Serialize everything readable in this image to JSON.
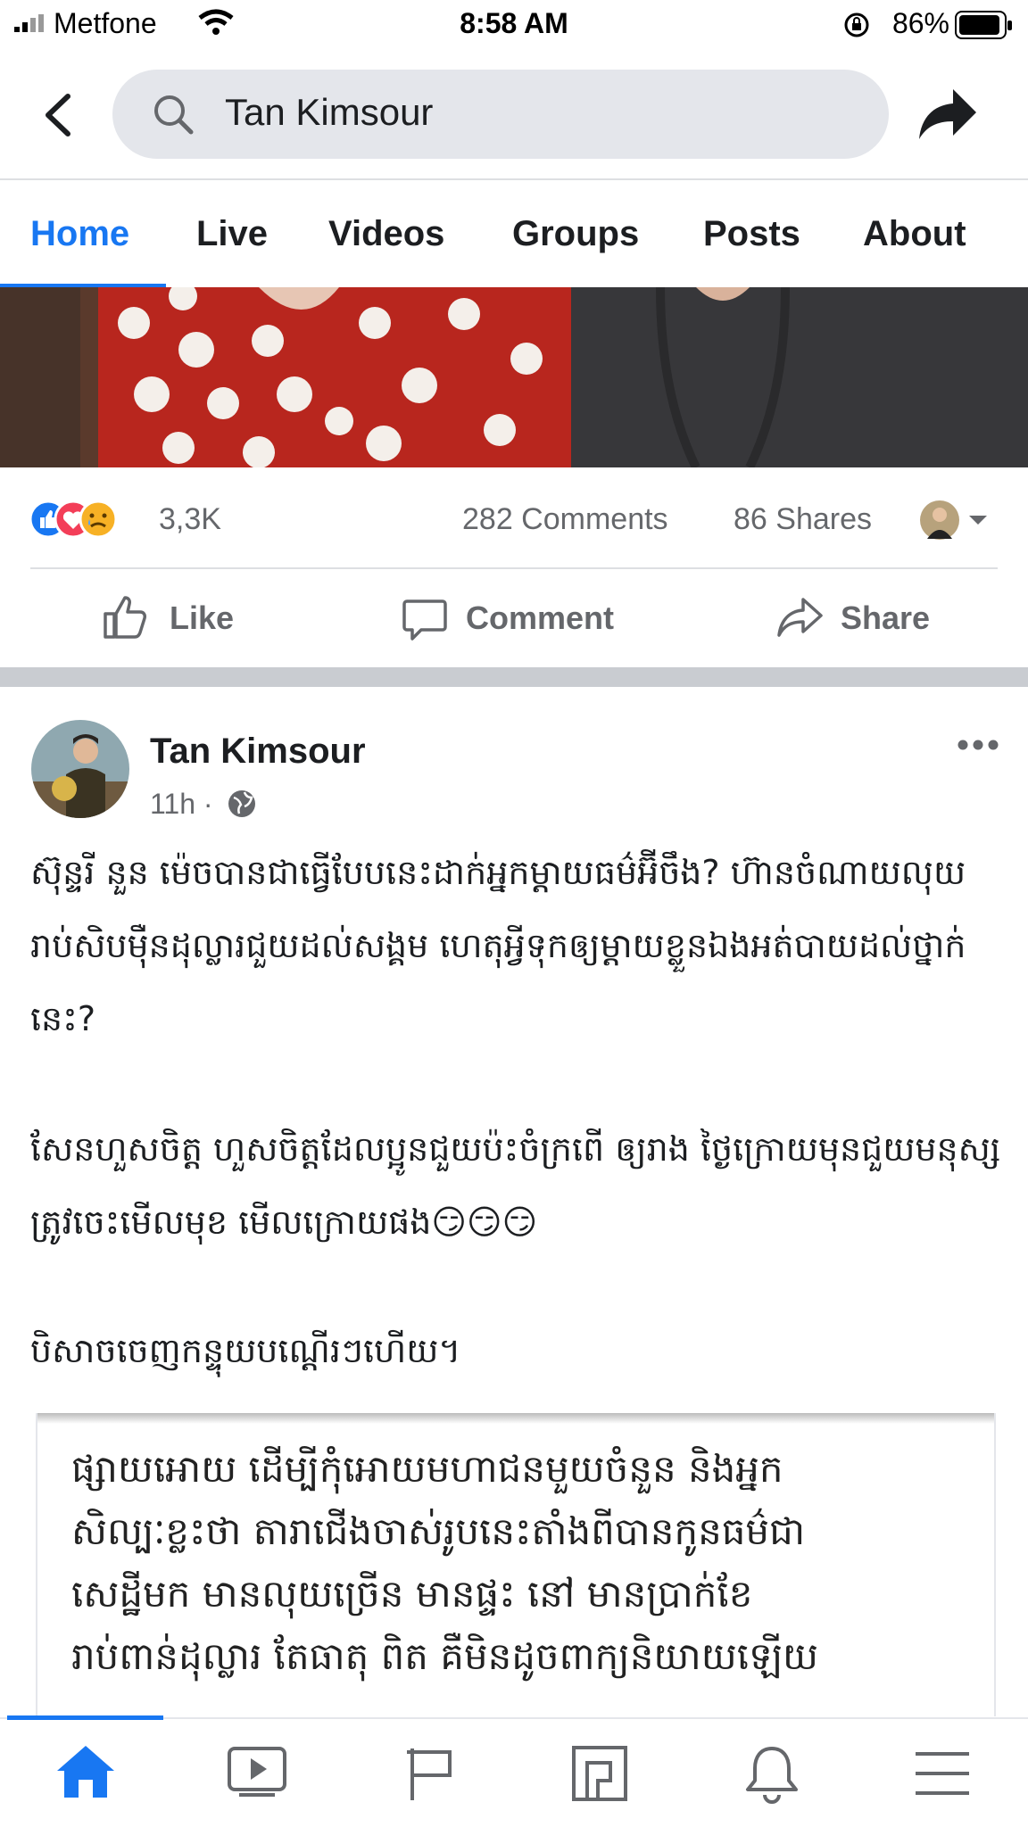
{
  "status_bar": {
    "carrier": "Metfone",
    "time": "8:58 AM",
    "battery": "86%"
  },
  "header": {
    "search_value": "Tan Kimsour",
    "icons": [
      "back-arrow-icon",
      "search-icon",
      "share-arrow-icon"
    ]
  },
  "tabs": [
    {
      "label": "Home",
      "active": true
    },
    {
      "label": "Live"
    },
    {
      "label": "Videos"
    },
    {
      "label": "Groups"
    },
    {
      "label": "Posts"
    },
    {
      "label": "About"
    }
  ],
  "feedback": {
    "reactions": "3,3K",
    "reaction_icons": [
      "like-reaction-icon",
      "love-reaction-icon",
      "sad-reaction-icon"
    ],
    "comments": "282 Comments",
    "shares": "86 Shares"
  },
  "actions": {
    "like": "Like",
    "comment": "Comment",
    "share": "Share"
  },
  "post": {
    "author": "Tan Kimsour",
    "time": "11h ·",
    "paragraphs": [
      "ស៊ុន្ទរី នួន ម៉េចបានជាធ្វើបែបនេះដាក់អ្នកម្តាយធម៌អ៊ីចឹង? ហ៊ានចំណាយលុយរាប់សិបម៉ឺនដុល្លារជួយដល់សង្គម ហេតុអ្វីទុកឲ្យម្តាយខ្លួនឯងអត់បាយដល់ថ្នាក់នេះ?",
      "សែនហួសចិត្ត ហួសចិត្តដែលប្អូនជួយប៉ះចំក្រពើ ឲ្យរាង ថ្ងៃក្រោយមុនជួយមនុស្ស ត្រូវចេះមើលមុខ មើលក្រោយផង😏😏😏",
      "បិសាចចេញកន្ទុយបណ្តើរៗហើយ។"
    ],
    "embedded_image_text": [
      "ផ្សាយអោយ ដើម្បីកុំអោយមហាជនមួយចំនួន និងអ្នក",
      "សិល្បៈខ្លះថា តារាជើងចាស់រូបនេះតាំងពីបានកូនធម៌ជា",
      "សេដ្ឋីមក មានលុយច្រើន មានផ្ទះ នៅ មានប្រាក់ខែ",
      "រាប់ពាន់ដុល្លារ តែធាតុ ពិត គឺមិនដូចពាក្យនិយាយឡើយ"
    ]
  },
  "bottom_nav": {
    "items": [
      "home-icon",
      "watch-icon",
      "pages-flag-icon",
      "marketplace-icon",
      "notifications-bell-icon",
      "menu-icon"
    ],
    "active": "home-icon"
  },
  "colors": {
    "accent": "#1877f2",
    "secondary_text": "#65676b",
    "search_bg": "#e4e6eb"
  }
}
